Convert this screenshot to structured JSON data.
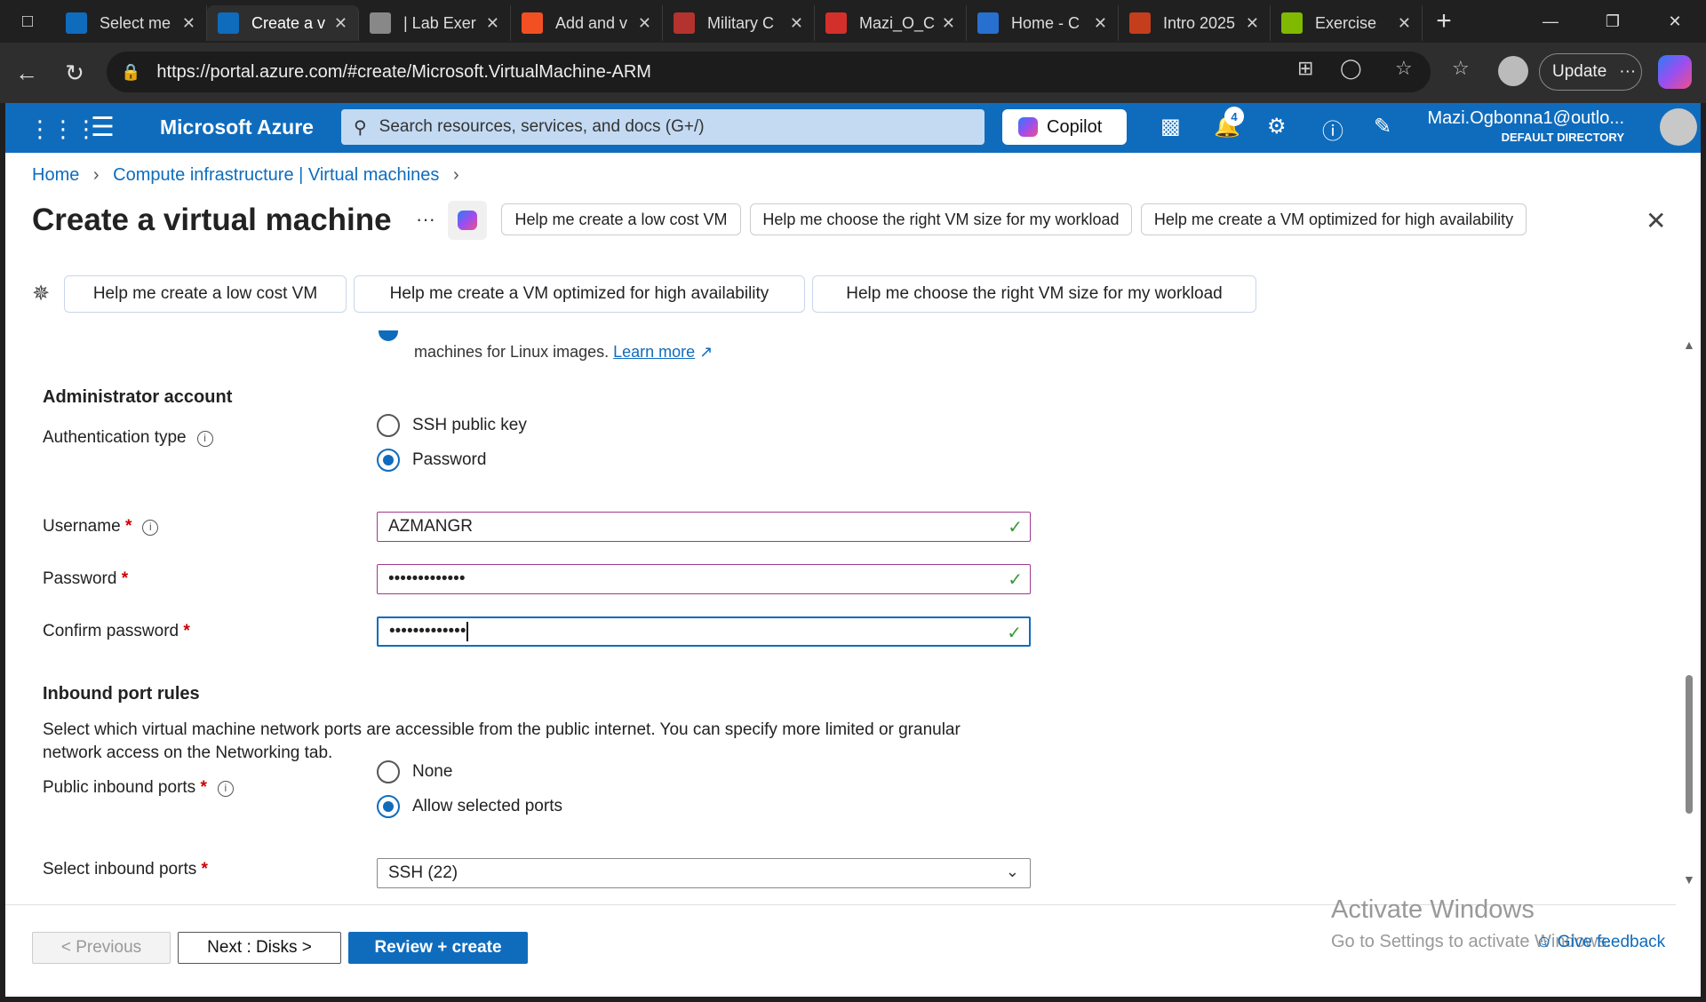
{
  "browser": {
    "tabs": [
      {
        "label": "Select me",
        "icon": "azure-icon",
        "color": "#0f6cbd"
      },
      {
        "label": "Create a v",
        "icon": "azure-icon",
        "color": "#0f6cbd",
        "active": true
      },
      {
        "label": "| Lab Exer",
        "icon": "globe-icon",
        "color": "#888888"
      },
      {
        "label": "Add and v",
        "icon": "microsoft-icon",
        "color": "#f25022"
      },
      {
        "label": "Military C",
        "icon": "pdf-icon",
        "color": "#b4332e"
      },
      {
        "label": "Mazi_O_C",
        "icon": "pdf-icon",
        "color": "#d4302b"
      },
      {
        "label": "Home - C",
        "icon": "onedrive-icon",
        "color": "#2870d0"
      },
      {
        "label": "Intro 2025",
        "icon": "powerpoint-icon",
        "color": "#c43e1c"
      },
      {
        "label": "Exercise",
        "icon": "microsoft-icon",
        "color": "#7fba00"
      }
    ],
    "url": "https://portal.azure.com/#create/Microsoft.VirtualMachine-ARM",
    "update_label": "Update"
  },
  "azure": {
    "brand": "Microsoft Azure",
    "search_placeholder": "Search resources, services, and docs (G+/)",
    "copilot_label": "Copilot",
    "notification_count": "4",
    "account_email": "Mazi.Ogbonna1@outlo...",
    "account_directory": "DEFAULT DIRECTORY"
  },
  "breadcrumb": {
    "home": "Home",
    "parent": "Compute infrastructure | Virtual machines"
  },
  "page": {
    "title": "Create a virtual machine",
    "more": "···",
    "title_suggestions": [
      "Help me create a low cost VM",
      "Help me choose the right VM size for my workload",
      "Help me create a VM optimized for high availability"
    ],
    "suggestions": [
      "Help me create a low cost VM",
      "Help me create a VM optimized for high availability",
      "Help me choose the right VM size for my workload"
    ]
  },
  "form": {
    "info_text": "machines for Linux images.",
    "info_link": "Learn more",
    "admin_heading": "Administrator account",
    "auth_label": "Authentication type",
    "auth_options": [
      "SSH public key",
      "Password"
    ],
    "auth_selected": "Password",
    "username_label": "Username",
    "username_value": "AZMANGR",
    "password_label": "Password",
    "password_value": "•••••••••••••",
    "confirm_label": "Confirm password",
    "confirm_value": "•••••••••••••",
    "inbound_heading": "Inbound port rules",
    "inbound_desc": "Select which virtual machine network ports are accessible from the public internet. You can specify more limited or granular network access on the Networking tab.",
    "public_ports_label": "Public inbound ports",
    "public_ports_options": [
      "None",
      "Allow selected ports"
    ],
    "public_ports_selected": "Allow selected ports",
    "select_ports_label": "Select inbound ports",
    "select_ports_value": "SSH (22)"
  },
  "footer": {
    "previous": "< Previous",
    "next": "Next : Disks >",
    "review": "Review + create",
    "feedback": "Give feedback"
  },
  "watermark": {
    "line1": "Activate Windows",
    "line2": "Go to Settings to activate Windows."
  }
}
